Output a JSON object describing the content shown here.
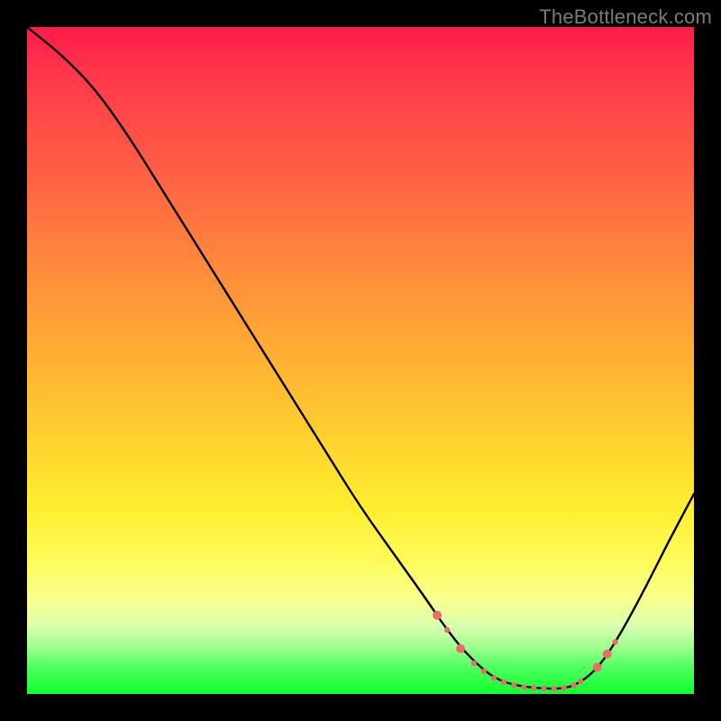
{
  "attribution": "TheBottleneck.com",
  "chart_data": {
    "type": "line",
    "title": "",
    "xlabel": "",
    "ylabel": "",
    "xlim": [
      0,
      100
    ],
    "ylim": [
      0,
      100
    ],
    "grid": false,
    "legend": false,
    "series": [
      {
        "name": "curve",
        "color": "#000000",
        "x": [
          0,
          5,
          10,
          15,
          20,
          25,
          30,
          35,
          40,
          45,
          50,
          55,
          60,
          62,
          65,
          68,
          70,
          72,
          75,
          78,
          80,
          82,
          85,
          88,
          92,
          96,
          100
        ],
        "y": [
          100,
          96,
          91,
          84,
          76,
          68,
          60,
          52,
          44,
          36,
          28,
          21,
          14,
          11,
          7,
          4,
          2.5,
          1.6,
          1.0,
          0.8,
          0.8,
          1.2,
          3.2,
          7.3,
          14.5,
          22.5,
          30
        ]
      }
    ],
    "flat_zone_markers": {
      "color": "#ed6b66",
      "radius_small": 3.2,
      "radius_large": 5.0,
      "points": [
        {
          "x": 61.5,
          "y": 11.8,
          "r": "large"
        },
        {
          "x": 63.0,
          "y": 9.6,
          "r": "small"
        },
        {
          "x": 65.0,
          "y": 6.8,
          "r": "large"
        },
        {
          "x": 67.0,
          "y": 4.6,
          "r": "small"
        },
        {
          "x": 68.5,
          "y": 3.4,
          "r": "small"
        },
        {
          "x": 70.0,
          "y": 2.4,
          "r": "small"
        },
        {
          "x": 71.5,
          "y": 1.8,
          "r": "small"
        },
        {
          "x": 73.0,
          "y": 1.3,
          "r": "small"
        },
        {
          "x": 74.5,
          "y": 1.0,
          "r": "small"
        },
        {
          "x": 76.0,
          "y": 0.9,
          "r": "small"
        },
        {
          "x": 77.5,
          "y": 0.8,
          "r": "small"
        },
        {
          "x": 79.0,
          "y": 0.8,
          "r": "small"
        },
        {
          "x": 80.5,
          "y": 0.9,
          "r": "small"
        },
        {
          "x": 82.0,
          "y": 1.3,
          "r": "small"
        },
        {
          "x": 83.0,
          "y": 1.9,
          "r": "small"
        },
        {
          "x": 85.5,
          "y": 4.0,
          "r": "large"
        },
        {
          "x": 87.0,
          "y": 6.0,
          "r": "large"
        },
        {
          "x": 88.2,
          "y": 7.8,
          "r": "small"
        }
      ]
    }
  }
}
